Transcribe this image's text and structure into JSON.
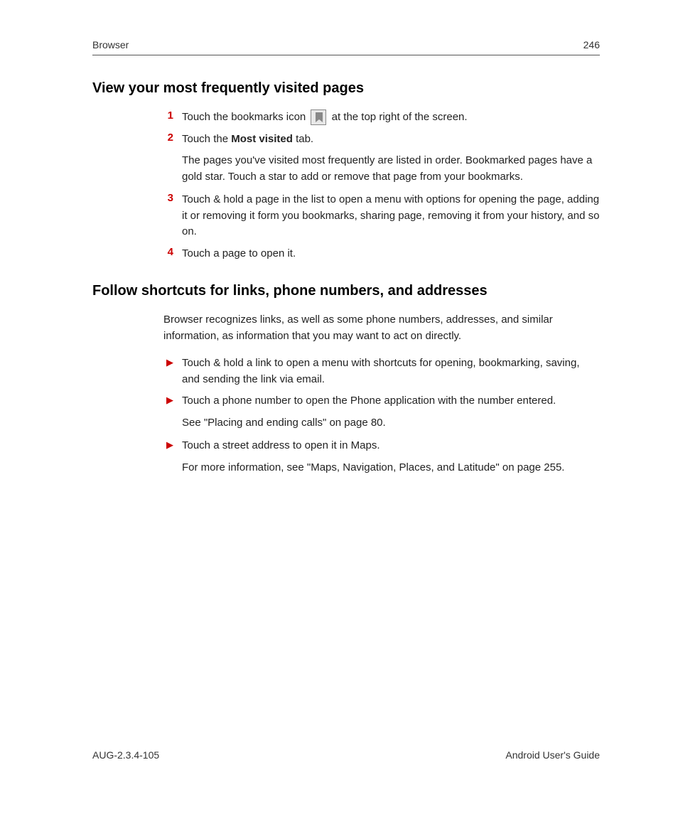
{
  "header": {
    "section": "Browser",
    "page": "246"
  },
  "section1": {
    "heading": "View your most frequently visited pages",
    "items": [
      {
        "num": "1",
        "pre": "Touch the bookmarks icon ",
        "post": " at the top right of the screen."
      },
      {
        "num": "2",
        "pre": "Touch the ",
        "bold": "Most visited",
        "post": " tab.",
        "sub": "The pages you've visited most frequently are listed in order. Bookmarked pages have a gold star. Touch a star to add or remove that page from your bookmarks."
      },
      {
        "num": "3",
        "text": "Touch & hold a page in the list to open a menu with options for opening the page, adding it or removing it form you bookmarks, sharing page, removing it from your history, and so on."
      },
      {
        "num": "4",
        "text": "Touch a page to open it."
      }
    ]
  },
  "section2": {
    "heading": "Follow shortcuts for links, phone numbers, and addresses",
    "intro": "Browser recognizes links, as well as some phone numbers, addresses, and similar information, as information that you may want to act on directly.",
    "items": [
      {
        "text": "Touch & hold a link to open a menu with shortcuts for opening, bookmarking, saving, and sending the link via email."
      },
      {
        "text": "Touch a phone number to open the Phone application with the number entered.",
        "sub": "See \"Placing and ending calls\" on page 80."
      },
      {
        "text": "Touch a street address to open it in Maps.",
        "sub": "For more information, see \"Maps, Navigation, Places, and Latitude\" on page 255."
      }
    ]
  },
  "footer": {
    "left": "AUG-2.3.4-105",
    "right": "Android User's Guide"
  }
}
